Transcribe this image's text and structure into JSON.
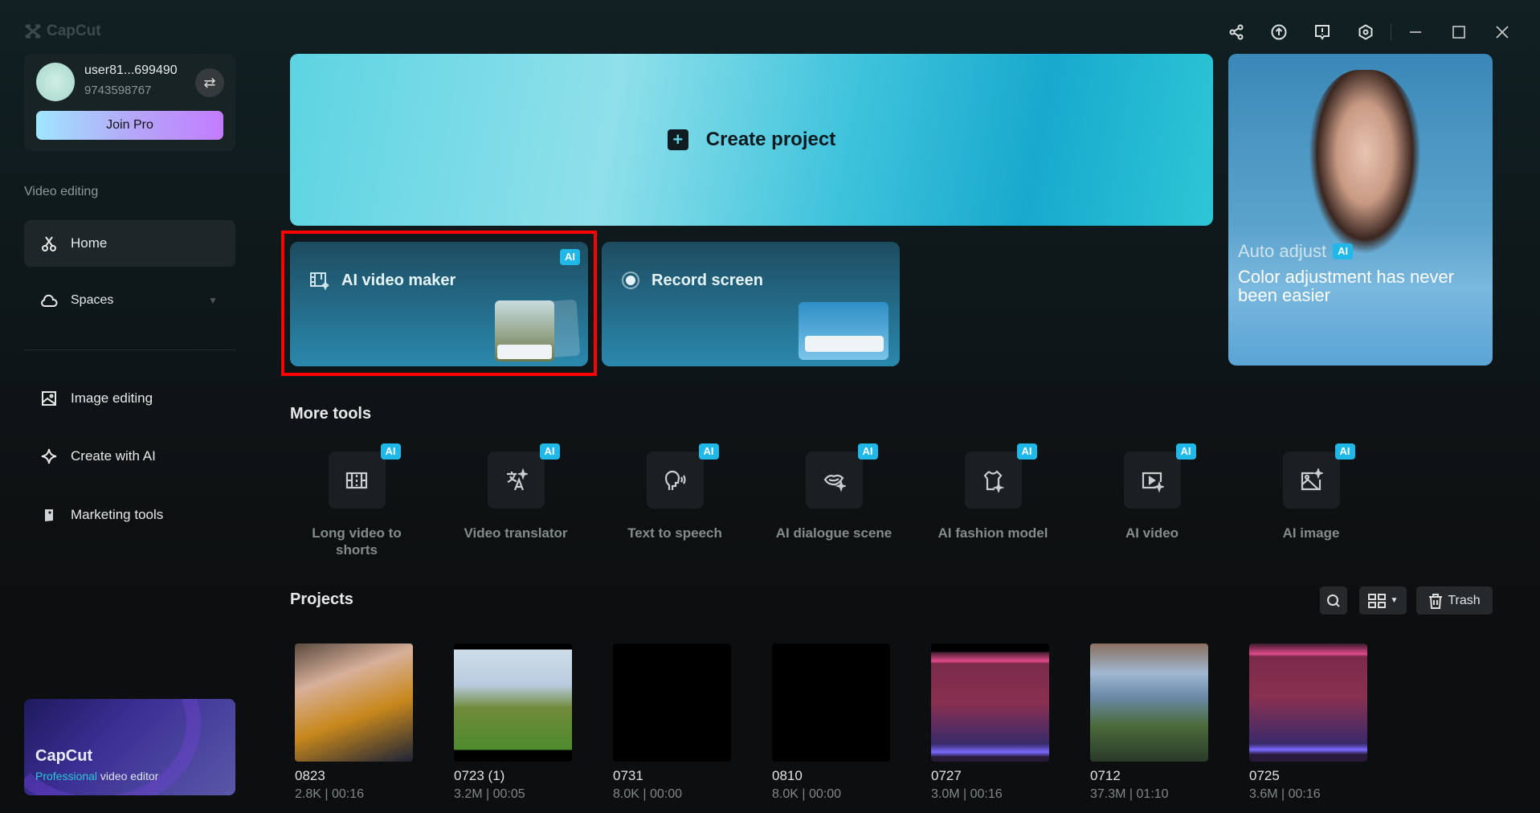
{
  "app": {
    "logo_text": "CapCut"
  },
  "window_controls": [
    "share-icon",
    "upload-icon",
    "feedback-icon",
    "settings-icon",
    "minimize-icon",
    "maximize-icon",
    "close-icon"
  ],
  "user": {
    "name": "user81...699490",
    "phone": "9743598767",
    "join_pro": "Join Pro"
  },
  "sidebar": {
    "section_label": "Video editing",
    "items": [
      {
        "label": "Home",
        "icon": "scissors-icon",
        "active": true
      },
      {
        "label": "Spaces",
        "icon": "cloud-icon"
      },
      {
        "label": "Image editing",
        "icon": "image-icon"
      },
      {
        "label": "Create with AI",
        "icon": "sparkle-icon"
      },
      {
        "label": "Marketing tools",
        "icon": "marketing-icon"
      }
    ]
  },
  "promo": {
    "title": "CapCut",
    "subtitle_accent": "Professional",
    "subtitle_rest": " video editor"
  },
  "create_project": {
    "label": "Create project"
  },
  "quick_cards": [
    {
      "label": "AI video maker",
      "badge": "AI"
    },
    {
      "label": "Record screen"
    }
  ],
  "banner": {
    "title": "Auto adjust",
    "badge": "AI",
    "text": "Color adjustment has never been easier"
  },
  "more_tools": {
    "title": "More tools",
    "items": [
      {
        "label": "Long video to shorts",
        "badge": "AI"
      },
      {
        "label": "Video translator",
        "badge": "AI"
      },
      {
        "label": "Text to speech",
        "badge": "AI"
      },
      {
        "label": "AI dialogue scene",
        "badge": "AI"
      },
      {
        "label": "AI fashion model",
        "badge": "AI"
      },
      {
        "label": "AI video",
        "badge": "AI"
      },
      {
        "label": "AI image",
        "badge": "AI"
      }
    ]
  },
  "projects": {
    "title": "Projects",
    "trash_label": "Trash",
    "items": [
      {
        "name": "0823",
        "meta": "2.8K | 00:16"
      },
      {
        "name": "0723 (1)",
        "meta": "3.2M | 00:05"
      },
      {
        "name": "0731",
        "meta": "8.0K | 00:00"
      },
      {
        "name": "0810",
        "meta": "8.0K | 00:00"
      },
      {
        "name": "0727",
        "meta": "3.0M | 00:16"
      },
      {
        "name": "0712",
        "meta": "37.3M | 01:10"
      },
      {
        "name": "0725",
        "meta": "3.6M | 00:16"
      }
    ]
  },
  "colors": {
    "accent_ai": "#1fb8e8",
    "highlight": "#ff0000"
  }
}
